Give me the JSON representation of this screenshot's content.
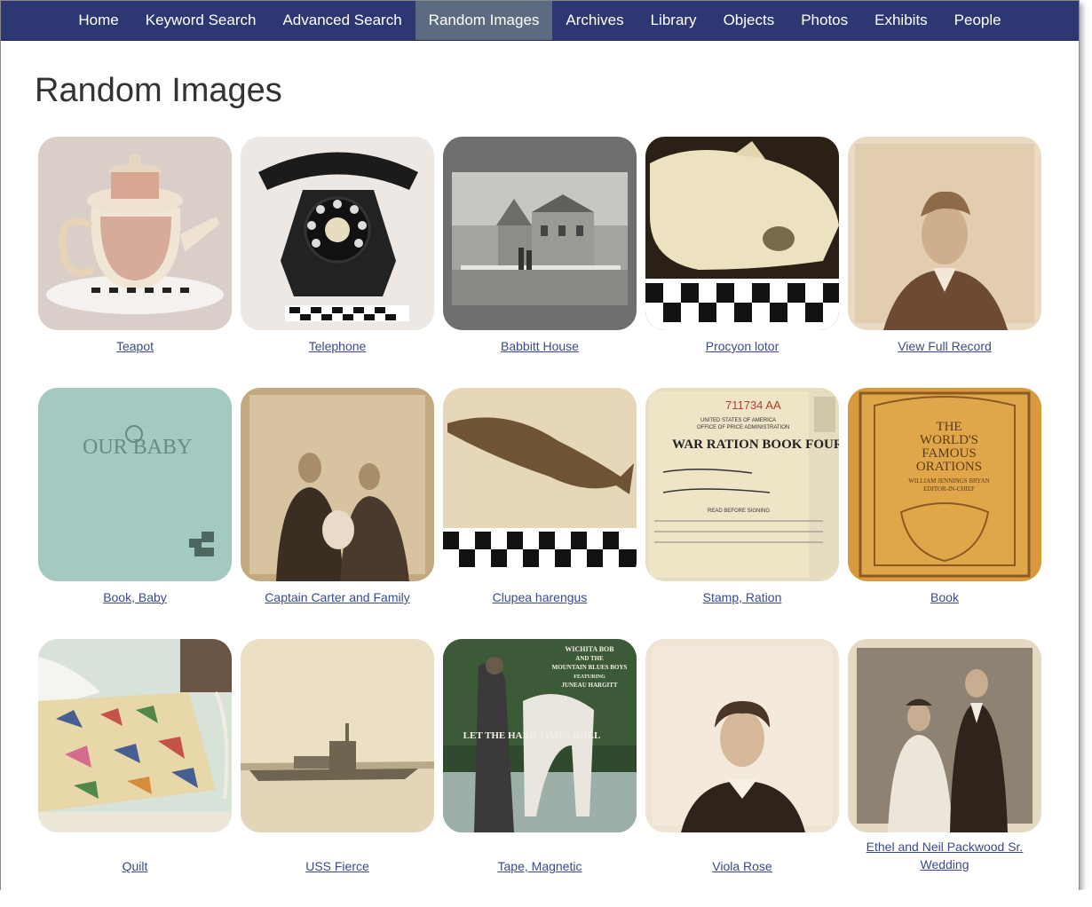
{
  "nav": {
    "items": [
      {
        "label": "Home"
      },
      {
        "label": "Keyword Search"
      },
      {
        "label": "Advanced Search"
      },
      {
        "label": "Random Images"
      },
      {
        "label": "Archives"
      },
      {
        "label": "Library"
      },
      {
        "label": "Objects"
      },
      {
        "label": "Photos"
      },
      {
        "label": "Exhibits"
      },
      {
        "label": "People"
      }
    ],
    "active_label": "Random Images"
  },
  "page": {
    "title": "Random Images"
  },
  "gallery": {
    "items": [
      {
        "caption": "Teapot",
        "icon": "teapot-image"
      },
      {
        "caption": "Telephone",
        "icon": "telephone-image"
      },
      {
        "caption": "Babbitt House",
        "icon": "house-photo"
      },
      {
        "caption": "Procyon lotor",
        "icon": "skull-image"
      },
      {
        "caption": "View Full Record",
        "icon": "portrait-photo"
      },
      {
        "caption": "Book, Baby",
        "icon": "baby-book-image"
      },
      {
        "caption": "Captain Carter and Family",
        "icon": "family-photo"
      },
      {
        "caption": "Clupea harengus",
        "icon": "fish-fossil-image"
      },
      {
        "caption": "Stamp, Ration",
        "icon": "ration-book-image",
        "texts": [
          "711734 AA",
          "UNITED STATES OF AMERICA",
          "OFFICE OF PRICE ADMINISTRATION",
          "WAR RATION BOOK FOUR",
          "READ BEFORE SIGNING"
        ]
      },
      {
        "caption": "Book",
        "icon": "book-cover-image",
        "texts": [
          "THE",
          "WORLD'S",
          "FAMOUS",
          "ORATIONS",
          "WILLIAM JENNINGS BRYAN",
          "EDITOR-IN-CHIEF"
        ]
      },
      {
        "caption": "Quilt",
        "icon": "quilt-image"
      },
      {
        "caption": "USS Fierce",
        "icon": "ship-photo"
      },
      {
        "caption": "Tape, Magnetic",
        "icon": "album-cover-image",
        "texts": [
          "WICHITA BOB",
          "AND THE",
          "MOUNTAIN BLUES BOYS",
          "FEATURING",
          "JUNEAU HARGITT",
          "LET THE HARD TIMES ROLL"
        ]
      },
      {
        "caption": "Viola Rose",
        "icon": "woman-portrait-photo"
      },
      {
        "caption": "Ethel and Neil Packwood Sr. Wedding",
        "icon": "wedding-photo"
      }
    ],
    "baby_book_text": "OUR BABY"
  },
  "colors": {
    "navbar": "#2d3771",
    "nav_active": "#5c6b80",
    "link": "#3b4a8c"
  }
}
